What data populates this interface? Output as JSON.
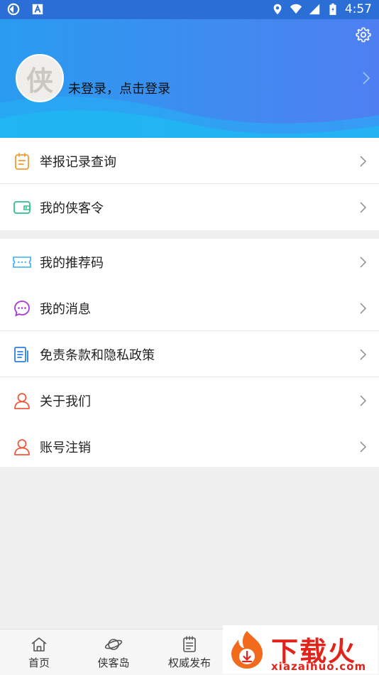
{
  "statusbar": {
    "time": "4:57"
  },
  "header": {
    "avatar_glyph": "侠",
    "login_text": "未登录，点击登录"
  },
  "menu": {
    "group1": [
      {
        "label": "举报记录查询",
        "icon": "clipboard-icon"
      },
      {
        "label": "我的侠客令",
        "icon": "wallet-icon"
      }
    ],
    "group2": [
      {
        "label": "我的推荐码",
        "icon": "ticket-icon"
      },
      {
        "label": "我的消息",
        "icon": "chat-bubble-icon"
      },
      {
        "label": "免责条款和隐私政策",
        "icon": "document-icon"
      },
      {
        "label": "关于我们",
        "icon": "person-icon"
      },
      {
        "label": "账号注销",
        "icon": "person-icon"
      }
    ]
  },
  "bottomnav": {
    "tabs": [
      {
        "label": "首页",
        "icon": "home-icon"
      },
      {
        "label": "侠客岛",
        "icon": "planet-icon"
      },
      {
        "label": "权威发布",
        "icon": "notepad-icon"
      }
    ]
  },
  "watermark": {
    "title": "下载火",
    "url": "xiazaihuo.com"
  },
  "colors": {
    "header_start": "#2a9cf0",
    "header_end": "#4f7ff2",
    "accent_orange": "#f39c32",
    "accent_green": "#2fc28a",
    "accent_cyan": "#3aaef0",
    "accent_purple": "#a43ad8",
    "accent_blue": "#2f7fe0",
    "accent_red": "#ef5a3c"
  }
}
